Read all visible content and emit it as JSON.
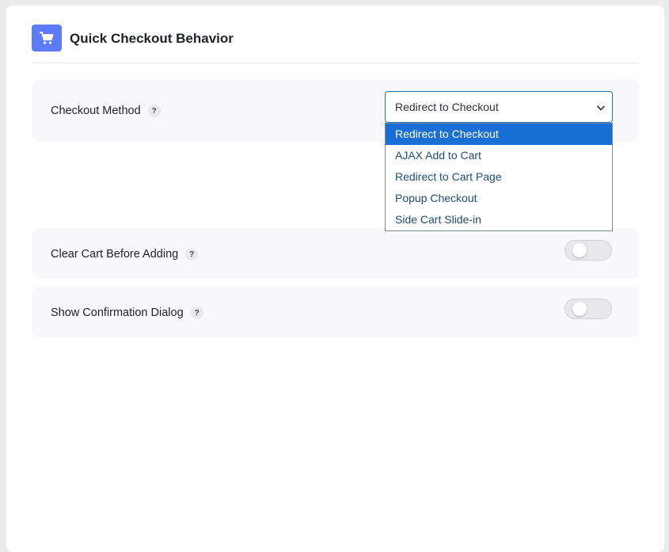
{
  "section": {
    "title": "Quick Checkout Behavior",
    "icon": "cart-icon",
    "accent_color": "#5b7cf6"
  },
  "checkout_method": {
    "label": "Checkout Method",
    "help": "?",
    "selected": "Redirect to Checkout",
    "options": [
      "Redirect to Checkout",
      "AJAX Add to Cart",
      "Redirect to Cart Page",
      "Popup Checkout",
      "Side Cart Slide-in"
    ]
  },
  "clear_cart": {
    "label": "Clear Cart Before Adding",
    "help": "?",
    "enabled": false
  },
  "confirmation_dialog": {
    "label": "Show Confirmation Dialog",
    "help": "?",
    "enabled": false
  }
}
